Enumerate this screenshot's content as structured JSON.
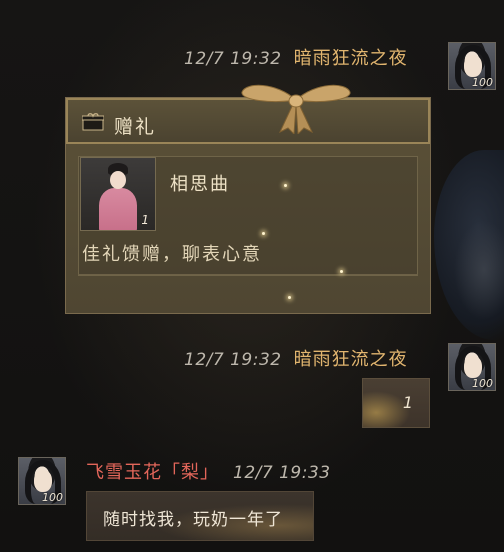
{
  "messages": [
    {
      "time": "12/7 19:32",
      "sender": "暗雨狂流之夜",
      "avatar_level": "100",
      "type": "gift",
      "gift": {
        "header": "赠礼",
        "item_name": "相思曲",
        "item_qty": "1",
        "message": "佳礼馈赠，聊表心意"
      }
    },
    {
      "time": "12/7 19:32",
      "sender": "暗雨狂流之夜",
      "avatar_level": "100",
      "type": "item",
      "qty": "1"
    },
    {
      "time": "12/7 19:33",
      "sender": "飞雪玉花「梨」",
      "avatar_level": "100",
      "type": "text",
      "text": "随时找我，玩奶一年了"
    }
  ],
  "colors": {
    "self_name": "#e1b56f",
    "other_name": "#e3665a",
    "card_bg": "#574d36"
  }
}
